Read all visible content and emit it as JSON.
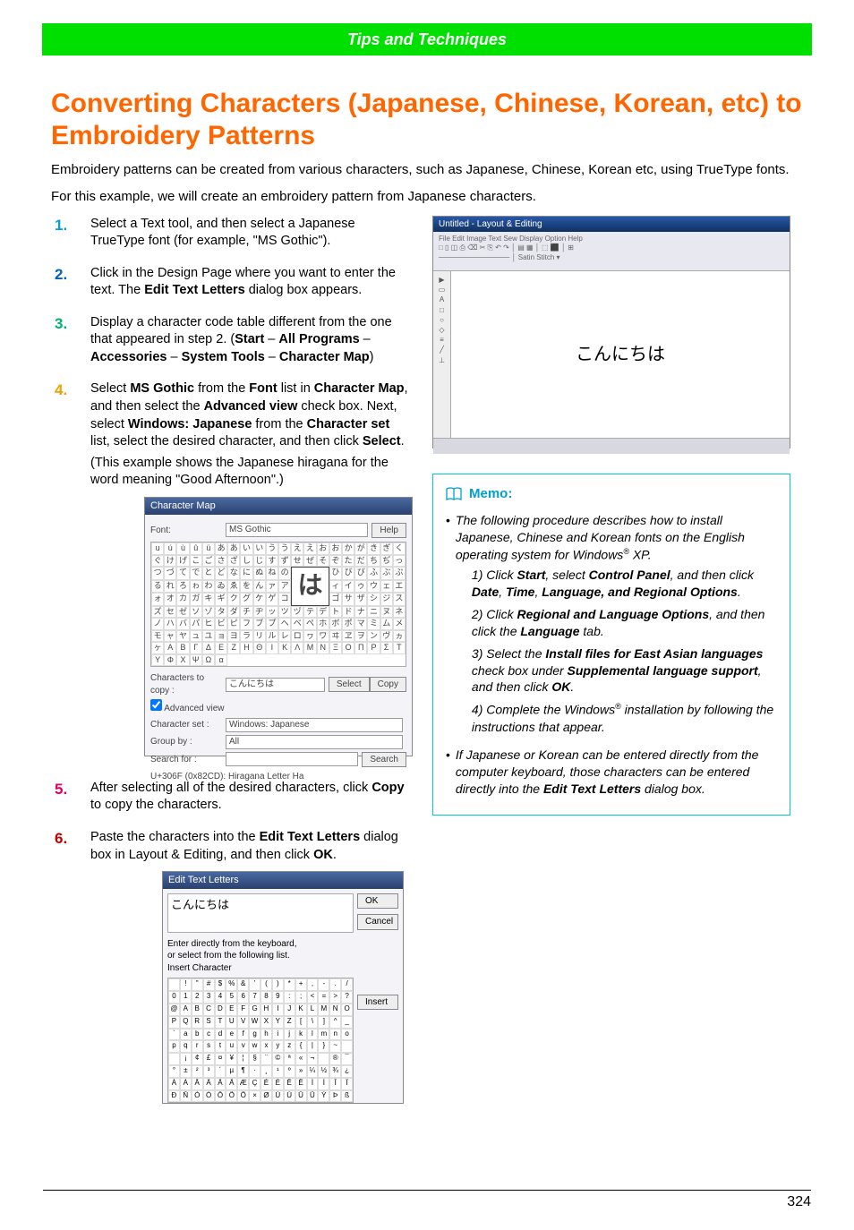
{
  "header": {
    "title": "Tips and Techniques"
  },
  "title": "Converting Characters (Japanese, Chinese, Korean, etc) to Embroidery Patterns",
  "intro1": "Embroidery patterns can be created from various characters, such as Japanese, Chinese, Korean etc, using TrueType fonts.",
  "intro2": "For this example, we will create an embroidery pattern from Japanese characters.",
  "steps": {
    "s1": "Select a Text tool, and then select a Japanese TrueType font (for example, \"MS Gothic\").",
    "s2a": "Click in the Design Page where you want to enter the text. The ",
    "s2b": "Edit Text Letters",
    "s2c": " dialog box appears.",
    "s3a": "Display a character code table different from the one that appeared in step 2. (",
    "s3b": "Start",
    "s3c": "All Programs",
    "s3d": "Accessories",
    "s3e": "System Tools",
    "s3f": "Character Map",
    "s3sep": " – ",
    "s3end": ")",
    "s4a": "Select ",
    "s4b": "MS Gothic",
    "s4c": " from the ",
    "s4d": "Font",
    "s4e": " list in ",
    "s4f": "Character Map",
    "s4g": ", and then select the ",
    "s4h": "Advanced view",
    "s4i": " check box. Next, select ",
    "s4j": "Windows: Japanese",
    "s4k": " from the ",
    "s4l": "Character set",
    "s4m": " list, select the desired character, and then click ",
    "s4n": "Select",
    "s4o": ".",
    "s4note": "(This example shows the Japanese hiragana for the word meaning \"Good Afternoon\".)",
    "s5a": "After selecting all of the desired characters, click ",
    "s5b": "Copy",
    "s5c": " to copy the characters.",
    "s6a": "Paste the characters into the ",
    "s6b": "Edit Text Letters",
    "s6c": " dialog box in Layout & Editing, and then click ",
    "s6d": "OK",
    "s6e": "."
  },
  "charmap": {
    "title": "Character Map",
    "font_label": "Font:",
    "font_value": "MS Gothic",
    "help": "Help",
    "big_char": "は",
    "copy_label": "Characters to copy :",
    "copy_value": "こんにちは",
    "select_btn": "Select",
    "copy_btn": "Copy",
    "adv_label": "Advanced view",
    "charset_label": "Character set :",
    "charset_value": "Windows: Japanese",
    "groupby_label": "Group by :",
    "groupby_value": "All",
    "search_label": "Search for :",
    "search_btn": "Search",
    "status": "U+306F (0x82CD): Hiragana Letter Ha"
  },
  "edit_dialog": {
    "title": "Edit Text Letters",
    "text_value": "こんにちは",
    "hint1": "Enter directly from the keyboard,",
    "hint2": "or select from the following list.",
    "insert_label": "Insert Character",
    "ok": "OK",
    "cancel": "Cancel",
    "insert": "Insert"
  },
  "app": {
    "title": "Untitled - Layout & Editing",
    "canvas_text": "こんにちは",
    "side_labels": "▶\nA\n□\n◯\n△\n╱"
  },
  "memo": {
    "heading": "Memo:",
    "b1a": "The following procedure describes how to install Japanese, Chinese and Korean fonts on the English operating system for Windows",
    "b1b": " XP.",
    "sub1a": "1) Click ",
    "sub1b": "Start",
    "sub1c": ", select ",
    "sub1d": "Control Panel",
    "sub1e": ", and then click ",
    "sub1f": "Date",
    "sub1g": "Time",
    "sub1h": "Language, and Regional Options",
    "sep": ", ",
    "dot": ".",
    "sub2a": "2) Click ",
    "sub2b": "Regional and Language Options",
    "sub2c": ", and then click the ",
    "sub2d": "Language",
    "sub2e": " tab.",
    "sub3a": "3) Select the ",
    "sub3b": "Install files for East Asian languages",
    "sub3c": " check box under ",
    "sub3d": "Supplemental language support",
    "sub3e": ", and then click ",
    "sub3f": "OK",
    "sub4a": "4) Complete the Windows",
    "sub4b": " installation by following the instructions that appear.",
    "b2a": "If Japanese or Korean can be entered directly from the computer keyboard, those characters can be entered directly into the ",
    "b2b": "Edit Text Letters",
    "b2c": " dialog box."
  },
  "page_number": "324"
}
